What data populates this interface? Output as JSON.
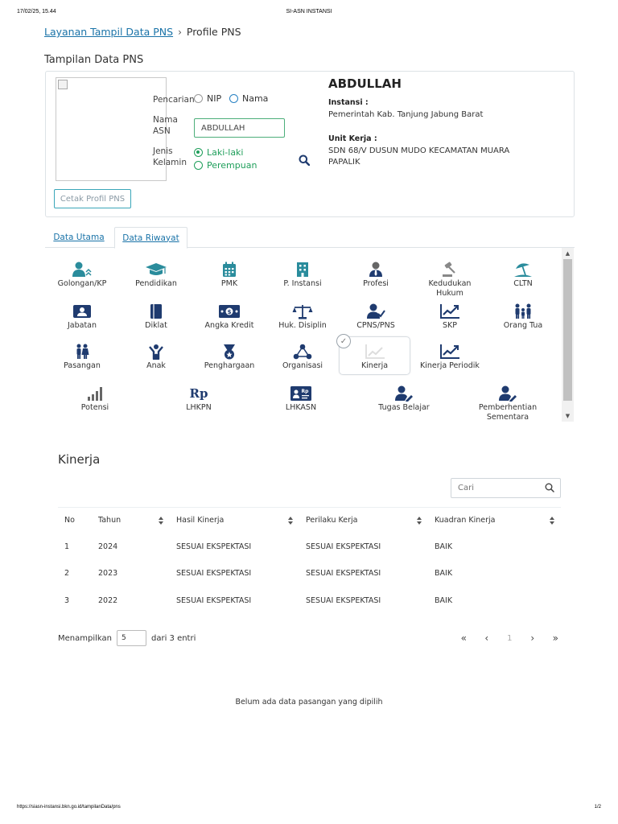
{
  "print": {
    "date": "17/02/25, 15.44",
    "title": "SI-ASN INSTANSI",
    "url": "https://siasn-instansi.bkn.go.id/tampilanData/pns",
    "page": "1/2"
  },
  "breadcrumb": {
    "link": "Layanan Tampil Data PNS",
    "separator": "›",
    "current": "Profile PNS"
  },
  "section_title": "Tampilan Data PNS",
  "profile": {
    "name": "ABDULLAH",
    "instansi_label": "Instansi :",
    "instansi_value": "Pemerintah Kab. Tanjung Jabung Barat",
    "unit_label": "Unit Kerja :",
    "unit_value": "SDN 68/V DUSUN MUDO KECAMATAN MUARA PAPALIK"
  },
  "search_form": {
    "pencarian_label": "Pencarian",
    "nip_label": "NIP",
    "nama_label": "Nama",
    "nama_asn_label": "Nama ASN",
    "nama_asn_value": "ABDULLAH",
    "jk_label": "Jenis Kelamin",
    "laki_label": "Laki-laki",
    "perempuan_label": "Perempuan",
    "print_button": "Cetak Profil PNS"
  },
  "tabs": [
    "Data Utama",
    "Data Riwayat"
  ],
  "icon_grid": [
    {
      "label": "Golongan/KP",
      "icon": "user-up-icon"
    },
    {
      "label": "Pendidikan",
      "icon": "graduation-cap-icon"
    },
    {
      "label": "PMK",
      "icon": "calendar-icon"
    },
    {
      "label": "P. Instansi",
      "icon": "building-icon"
    },
    {
      "label": "Profesi",
      "icon": "user-tie-icon"
    },
    {
      "label": "Kedudukan Hukum",
      "icon": "gavel-icon"
    },
    {
      "label": "CLTN",
      "icon": "umbrella-beach-icon"
    },
    {
      "label": "Jabatan",
      "icon": "id-badge-icon"
    },
    {
      "label": "Diklat",
      "icon": "book-icon"
    },
    {
      "label": "Angka Kredit",
      "icon": "money-icon"
    },
    {
      "label": "Huk. Disiplin",
      "icon": "scale-icon"
    },
    {
      "label": "CPNS/PNS",
      "icon": "user-check-icon"
    },
    {
      "label": "SKP",
      "icon": "chart-line-icon"
    },
    {
      "label": "Orang Tua",
      "icon": "family-icon"
    },
    {
      "label": "Pasangan",
      "icon": "couple-icon"
    },
    {
      "label": "Anak",
      "icon": "child-icon"
    },
    {
      "label": "Penghargaan",
      "icon": "medal-icon"
    },
    {
      "label": "Organisasi",
      "icon": "network-icon"
    },
    {
      "label": "Kinerja",
      "icon": "chart-area-icon"
    },
    {
      "label": "Kinerja Periodik",
      "icon": "chart-line-icon"
    },
    {
      "label": "Potensi",
      "icon": "bar-chart-icon"
    },
    {
      "label": "LHKPN",
      "icon": "rupiah-icon"
    },
    {
      "label": "LHKASN",
      "icon": "rupiah-card-icon"
    },
    {
      "label": "Tugas Belajar",
      "icon": "user-edit-icon"
    },
    {
      "label": "Pemberhentian Sementara",
      "icon": "user-edit-icon"
    }
  ],
  "selected_icon": "Kinerja",
  "kinerja": {
    "title": "Kinerja",
    "search_placeholder": "Cari",
    "columns": [
      "No",
      "Tahun",
      "Hasil Kinerja",
      "Perilaku Kerja",
      "Kuadran Kinerja"
    ],
    "rows": [
      [
        "1",
        "2024",
        "SESUAI EKSPEKTASI",
        "SESUAI EKSPEKTASI",
        "BAIK"
      ],
      [
        "2",
        "2023",
        "SESUAI EKSPEKTASI",
        "SESUAI EKSPEKTASI",
        "BAIK"
      ],
      [
        "3",
        "2022",
        "SESUAI EKSPEKTASI",
        "SESUAI EKSPEKTASI",
        "BAIK"
      ]
    ],
    "pagination": {
      "show_label": "Menampilkan",
      "page_size": "5",
      "total_label": "dari 3 entri",
      "current_page": "1"
    }
  },
  "empty_message": "Belum ada data pasangan yang dipilih",
  "colors": {
    "teal": "#2a8c9c",
    "navy": "#1f3b6f",
    "link": "#1a73a8",
    "green": "#1e9e5a"
  }
}
